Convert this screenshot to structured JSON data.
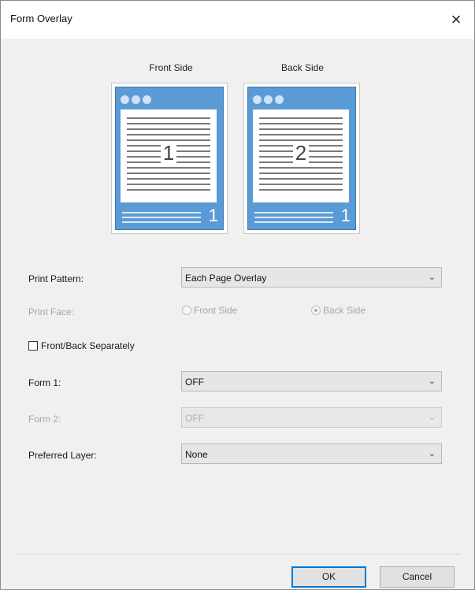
{
  "window": {
    "title": "Form Overlay",
    "close_glyph": "×"
  },
  "preview": {
    "front_label": "Front Side",
    "back_label": "Back Side",
    "front_page_number": "1",
    "back_page_number": "2",
    "front_corner_number": "1",
    "back_corner_number": "1"
  },
  "print_pattern": {
    "label": "Print Pattern:",
    "value": "Each Page Overlay"
  },
  "print_face": {
    "label": "Print Face:",
    "front_option": "Front Side",
    "back_option": "Back Side",
    "selected": "Back Side"
  },
  "front_back_separately": {
    "label": "Front/Back Separately",
    "checked": false
  },
  "form1": {
    "label": "Form 1:",
    "value": "OFF"
  },
  "form2": {
    "label": "Form 2:",
    "value": "OFF"
  },
  "preferred_layer": {
    "label": "Preferred Layer:",
    "value": "None"
  },
  "buttons": {
    "ok": "OK",
    "cancel": "Cancel"
  },
  "colors": {
    "accent": "#0078d7",
    "page_blue": "#5b9bd5"
  }
}
